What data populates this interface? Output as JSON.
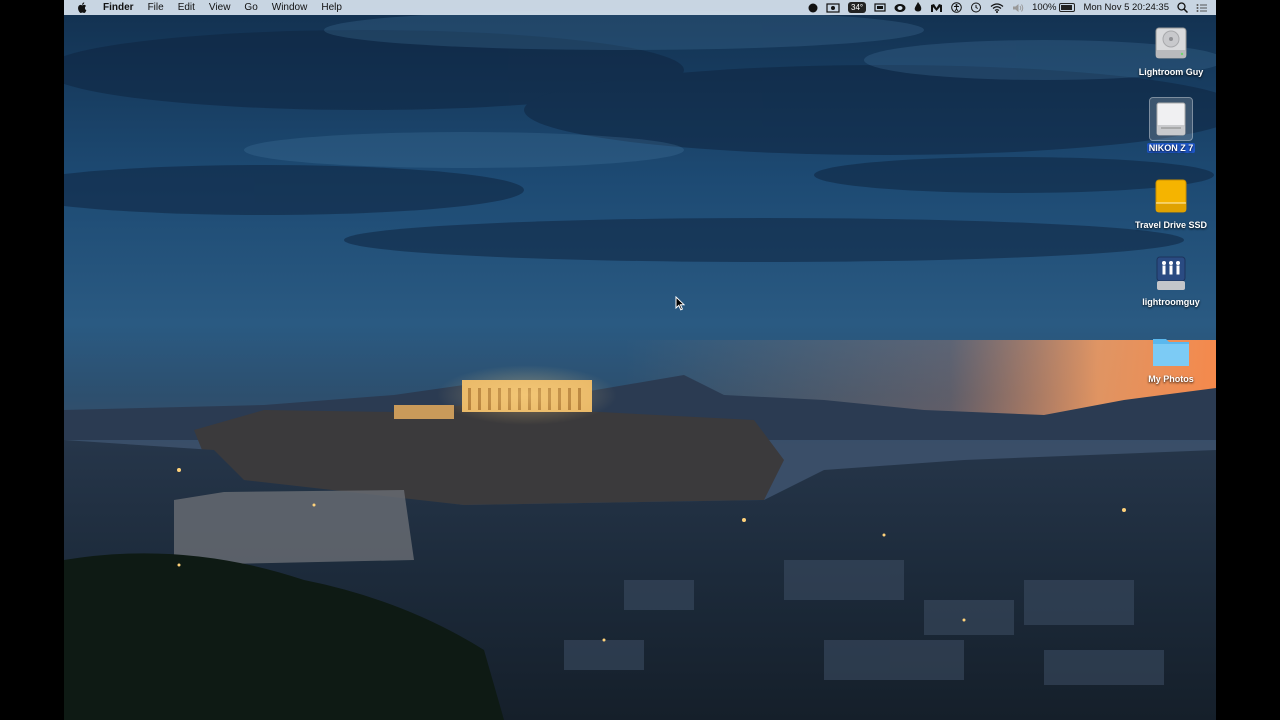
{
  "menubar": {
    "app_name": "Finder",
    "menus": [
      "File",
      "Edit",
      "View",
      "Go",
      "Window",
      "Help"
    ],
    "status": {
      "temperature": "34°",
      "battery_percent": "100%",
      "clock": "Mon Nov 5  20:24:35"
    }
  },
  "desktop_icons": [
    {
      "label": "Lightroom Guy",
      "icon": "internal-hard-drive-icon"
    },
    {
      "label": "NIKON Z 7",
      "icon": "memory-card-drive-icon",
      "selected": true
    },
    {
      "label": "Travel Drive SSD",
      "icon": "external-drive-icon"
    },
    {
      "label": "lightroomguy",
      "icon": "network-share-icon"
    },
    {
      "label": "My Photos",
      "icon": "folder-icon"
    }
  ],
  "colors": {
    "menubar_bg": "#d6e2ee",
    "selection_blue": "#1e56c6",
    "sky_top": "#1a3a5c",
    "sunset": "#ff9a55"
  }
}
